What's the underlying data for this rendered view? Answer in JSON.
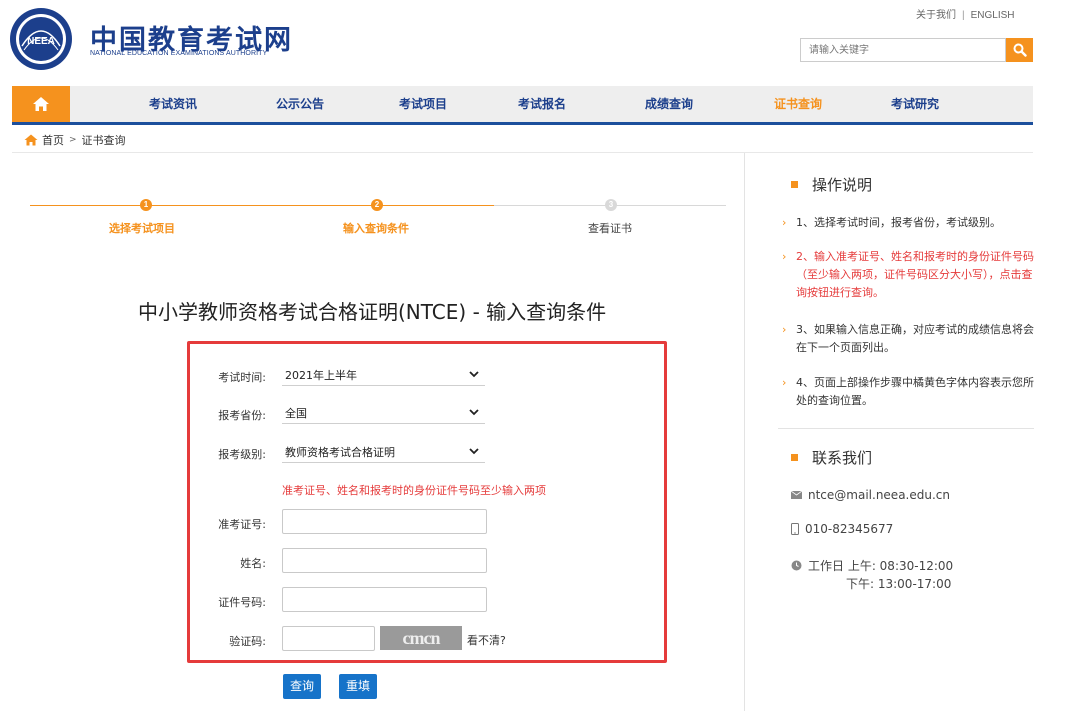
{
  "header": {
    "site_title": "中国教育考试网",
    "site_subtitle": "NATIONAL EDUCATION EXAMINATIONS AUTHORITY",
    "emblem_text": "NEEA",
    "links": [
      "关于我们",
      "ENGLISH"
    ],
    "search_placeholder": "请输入关键字"
  },
  "nav": {
    "items": [
      {
        "label": "考试资讯",
        "active": false
      },
      {
        "label": "公示公告",
        "active": false
      },
      {
        "label": "考试项目",
        "active": false
      },
      {
        "label": "考试报名",
        "active": false
      },
      {
        "label": "成绩查询",
        "active": false
      },
      {
        "label": "证书查询",
        "active": true
      },
      {
        "label": "考试研究",
        "active": false
      }
    ]
  },
  "breadcrumb": {
    "home": "首页",
    "separator": ">",
    "current": "证书查询"
  },
  "steps": [
    {
      "number": "1",
      "label": "选择考试项目",
      "state": "done"
    },
    {
      "number": "2",
      "label": "输入查询条件",
      "state": "done"
    },
    {
      "number": "3",
      "label": "查看证书",
      "state": "todo"
    }
  ],
  "page_title": "中小学教师资格考试合格证明(NTCE) - 输入查询条件",
  "form": {
    "exam_time_label": "考试时间:",
    "exam_time_value": "2021年上半年",
    "province_label": "报考省份:",
    "province_value": "全国",
    "level_label": "报考级别:",
    "level_value": "教师资格考试合格证明",
    "hint": "准考证号、姓名和报考时的身份证件号码至少输入两项",
    "admission_label": "准考证号:",
    "admission_value": "",
    "name_label": "姓名:",
    "name_value": "",
    "id_label": "证件号码:",
    "id_value": "",
    "captcha_label": "验证码:",
    "captcha_value": "",
    "captcha_text": "cmcn",
    "captcha_refresh": "看不清?",
    "submit_label": "查询",
    "reset_label": "重填"
  },
  "sidebar": {
    "instructions_title": "操作说明",
    "instructions": [
      {
        "text": "1、选择考试时间，报考省份，考试级别。",
        "highlight": false
      },
      {
        "text": "2、输入准考证号、姓名和报考时的身份证件号码（至少输入两项，证件号码区分大小写），点击查询按钮进行查询。",
        "highlight": true
      },
      {
        "text": "3、如果输入信息正确，对应考试的成绩信息将会在下一个页面列出。",
        "highlight": false
      },
      {
        "text": "4、页面上部操作步骤中橘黄色字体内容表示您所处的查询位置。",
        "highlight": false
      }
    ],
    "contact_title": "联系我们",
    "email": "ntce@mail.neea.edu.cn",
    "phone": "010-82345677",
    "hours_am": "工作日 上午: 08:30-12:00",
    "hours_pm": "下午: 13:00-17:00"
  },
  "colors": {
    "brand_blue": "#1c3f8c",
    "accent_orange": "#f5921e",
    "alert_red": "#e53b3b",
    "button_blue": "#1673c9"
  }
}
